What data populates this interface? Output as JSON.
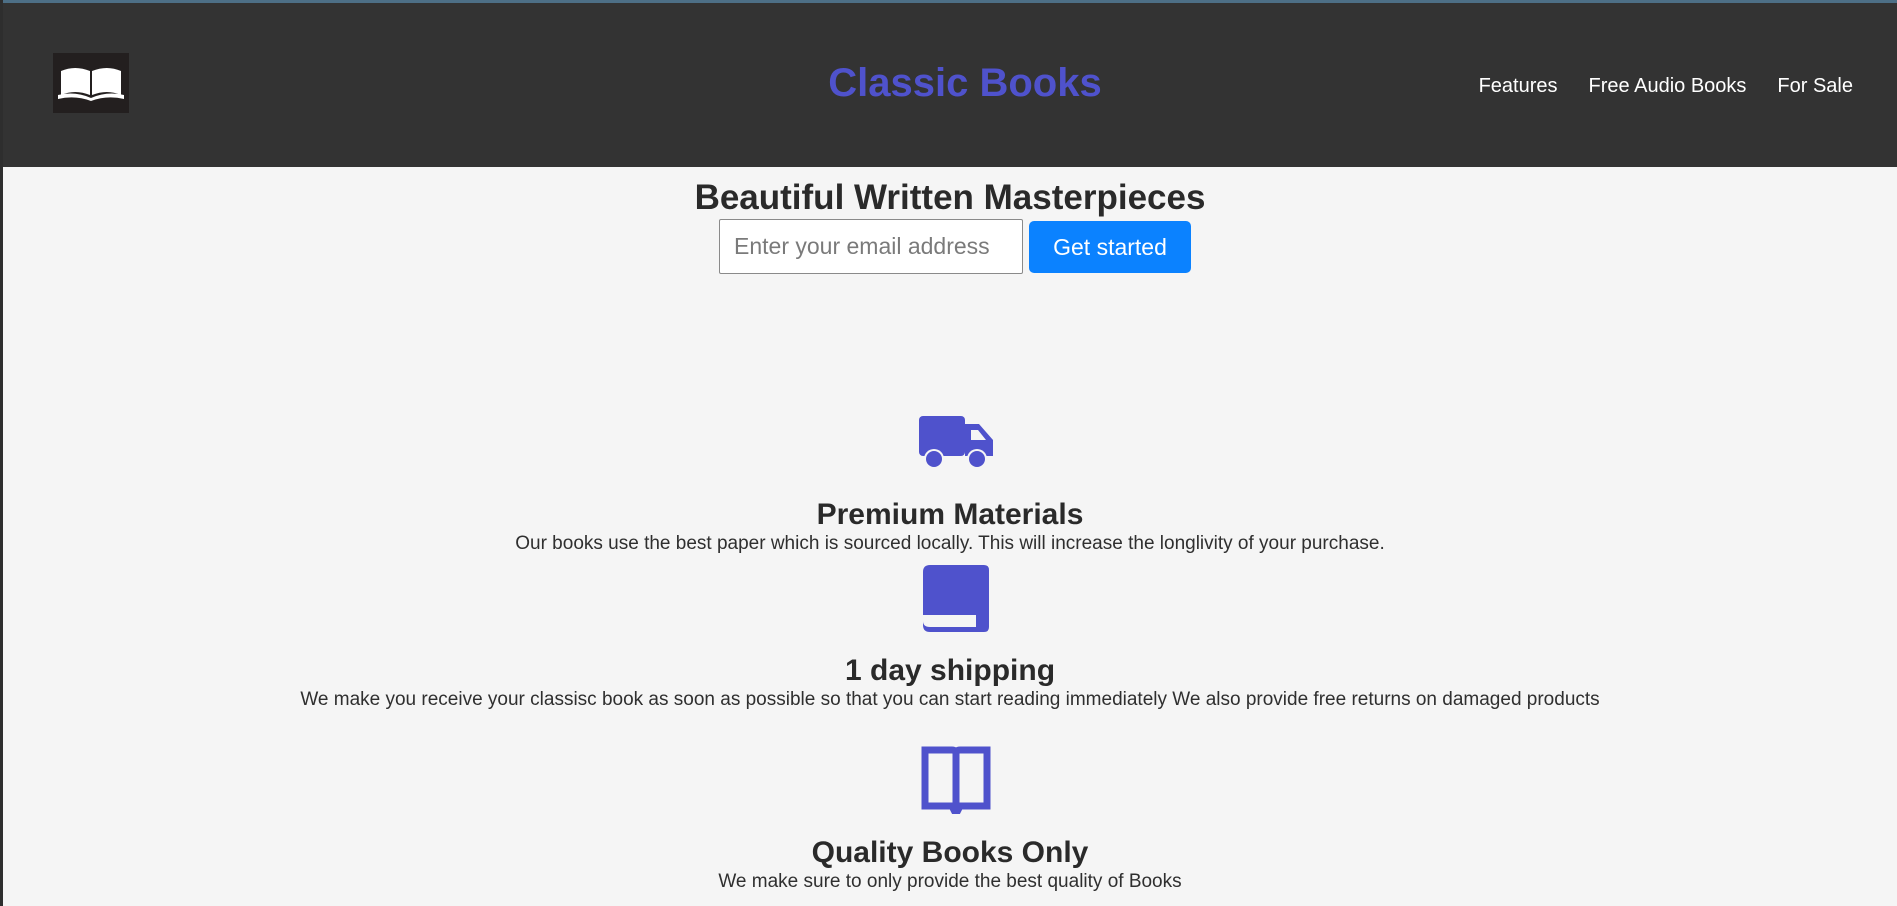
{
  "colors": {
    "header_bg": "#333333",
    "brand": "#4f52cc",
    "accent_button": "#0b82ff",
    "icon": "#4f52cc",
    "page_bg": "#f5f5f5"
  },
  "header": {
    "logo_icon": "open-book-icon",
    "brand": "Classic Books",
    "nav": [
      {
        "label": "Features"
      },
      {
        "label": "Free Audio Books"
      },
      {
        "label": "For Sale"
      }
    ]
  },
  "hero": {
    "title": "Beautiful Written Masterpieces",
    "email_placeholder": "Enter your email address",
    "email_value": "",
    "cta_label": "Get started"
  },
  "features": [
    {
      "icon": "truck-icon",
      "title": "Premium Materials",
      "description": "Our books use the best paper which is sourced locally. This will increase the longlivity of your purchase."
    },
    {
      "icon": "book-icon",
      "title": "1 day shipping",
      "description": "We make you receive your classisc book as soon as possible so that you can start reading immediately We also provide free returns on damaged products"
    },
    {
      "icon": "book-open-icon",
      "title": "Quality Books Only",
      "description": "We make sure to only provide the best quality of Books"
    }
  ]
}
